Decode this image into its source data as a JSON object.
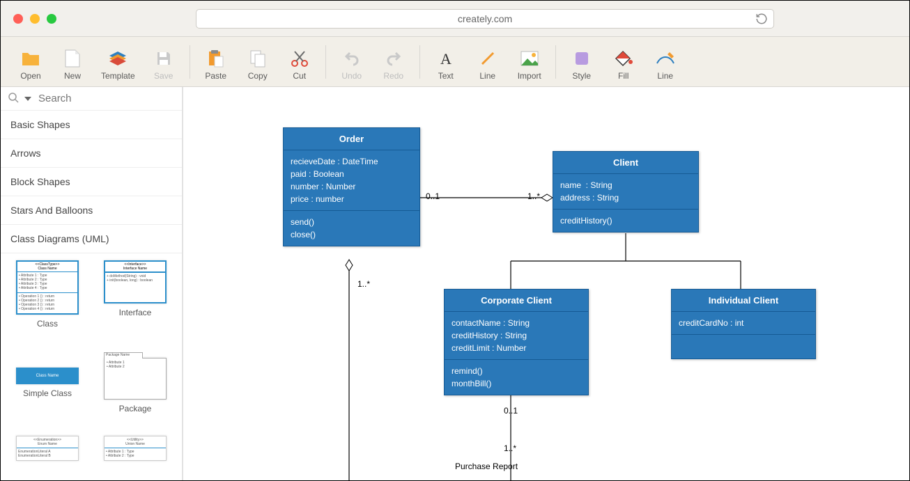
{
  "browser": {
    "url": "creately.com",
    "search_placeholder": "Search"
  },
  "toolbar": {
    "open": "Open",
    "new": "New",
    "template": "Template",
    "save": "Save",
    "paste": "Paste",
    "copy": "Copy",
    "cut": "Cut",
    "undo": "Undo",
    "redo": "Redo",
    "text": "Text",
    "line": "Line",
    "import": "Import",
    "style": "Style",
    "fill": "Fill",
    "line2": "Line"
  },
  "sidebar": {
    "categories": [
      "Basic Shapes",
      "Arrows",
      "Block Shapes",
      "Stars And Balloons",
      "Class Diagrams (UML)"
    ],
    "shapes": {
      "class": "Class",
      "interface": "Interface",
      "simple_class": "Simple Class",
      "package": "Package"
    }
  },
  "diagram": {
    "order": {
      "title": "Order",
      "attrs": "recieveDate : DateTime\npaid : Boolean\nnumber : Number\nprice : number",
      "ops": "send()\nclose()"
    },
    "client": {
      "title": "Client",
      "attrs": "name  : String\naddress : String",
      "ops": "creditHistory()"
    },
    "corporate": {
      "title": "Corporate Client",
      "attrs": "contactName : String\ncreditHistory : String\ncreditLimit : Number",
      "ops": "remind()\nmonthBill()"
    },
    "individual": {
      "title": "Individual Client",
      "attrs": "creditCardNo : int"
    },
    "labels": {
      "purchase_report": "Purchase Report",
      "m_0_1_a": "0..1",
      "m_1_star_a": "1..*",
      "m_1_star_b": "1..*",
      "m_0_1_b": "0..1",
      "m_1_star_c": "1..*"
    }
  }
}
